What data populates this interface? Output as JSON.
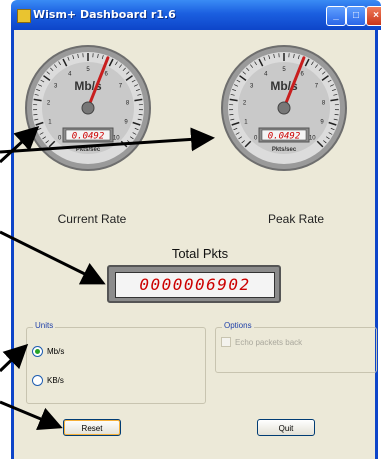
{
  "window": {
    "title": "Wism+ Dashboard r1.6",
    "minimize": "_",
    "maximize": "□",
    "close": "×"
  },
  "gauges": [
    {
      "caption": "Current Rate",
      "unit": "Mb/s",
      "display": "0.0492",
      "sublabel": "Pkts/sec",
      "scale": [
        "0",
        "1",
        "2",
        "3",
        "4",
        "5",
        "6",
        "7",
        "8",
        "9",
        "10"
      ],
      "needle_value": 5.8
    },
    {
      "caption": "Peak Rate",
      "unit": "Mb/s",
      "display": "0.0492",
      "sublabel": "Pkts/sec",
      "scale": [
        "0",
        "1",
        "2",
        "3",
        "4",
        "5",
        "6",
        "7",
        "8",
        "9",
        "10"
      ],
      "needle_value": 5.8
    }
  ],
  "total": {
    "label": "Total Pkts",
    "value": "0000006902"
  },
  "units": {
    "title": "Units",
    "options": [
      {
        "label": "Mb/s",
        "selected": true
      },
      {
        "label": "KB/s",
        "selected": false
      }
    ]
  },
  "options": {
    "title": "Options",
    "echo_label": "Echo packets back",
    "echo_checked": false,
    "enabled": false
  },
  "buttons": {
    "reset": "Reset",
    "quit": "Quit"
  },
  "colors": {
    "titlebar": "#1b5fe0",
    "digits": "#cc0000",
    "needle": "#c81e1e"
  }
}
